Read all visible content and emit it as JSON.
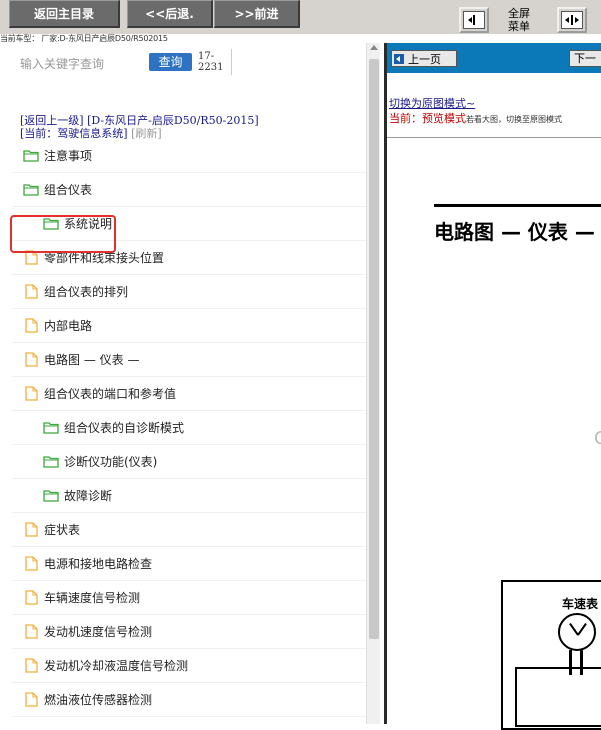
{
  "toolbar": {
    "back_main_label": "返回主目录",
    "back_label": "<<后退.",
    "forward_label": ">>前进",
    "fullscreen_line1": "全屏",
    "fullscreen_line2": "菜单",
    "vehicle_info": "当前车型： 厂家:D-东风日产启辰D50/R502015"
  },
  "search": {
    "placeholder": "输入关键字查询",
    "button_label": "查询",
    "code_line1": "17-",
    "code_line2": "2231"
  },
  "breadcrumb": {
    "back_up": "[返回上一级]",
    "path": "[D-东风日产-启辰D50/R50-2015]",
    "current": "[当前：驾驶信息系统]",
    "refresh": "[刷新]"
  },
  "tree": {
    "items": [
      {
        "label": "注意事项",
        "type": "folder",
        "level": 1
      },
      {
        "label": "组合仪表",
        "type": "folder",
        "level": 1,
        "highlighted": true
      },
      {
        "label": "系统说明",
        "type": "folder",
        "level": 2
      },
      {
        "label": "零部件和线束接头位置",
        "type": "doc",
        "level": 1
      },
      {
        "label": "组合仪表的排列",
        "type": "doc",
        "level": 1
      },
      {
        "label": "内部电路",
        "type": "doc",
        "level": 1
      },
      {
        "label": "电路图 — 仪表 —",
        "type": "doc",
        "level": 1
      },
      {
        "label": "组合仪表的端口和参考值",
        "type": "doc",
        "level": 1
      },
      {
        "label": "组合仪表的自诊断模式",
        "type": "folder",
        "level": 2
      },
      {
        "label": "诊断仪功能(仪表)",
        "type": "folder",
        "level": 2
      },
      {
        "label": "故障诊断",
        "type": "folder",
        "level": 2
      },
      {
        "label": "症状表",
        "type": "doc",
        "level": 1
      },
      {
        "label": "电源和接地电路检查",
        "type": "doc",
        "level": 1
      },
      {
        "label": "车辆速度信号检测",
        "type": "doc",
        "level": 1
      },
      {
        "label": "发动机速度信号检测",
        "type": "doc",
        "level": 1
      },
      {
        "label": "发动机冷却液温度信号检测",
        "type": "doc",
        "level": 1
      },
      {
        "label": "燃油液位传感器检测",
        "type": "doc",
        "level": 1
      }
    ]
  },
  "viewer": {
    "prev_page": "上一页",
    "next_page": "下一",
    "switch_mode": "切换为原图模式~",
    "current_mode": "当前：预览模式",
    "mode_hint": "若看大图，切换至原图模式",
    "heading": "电路图 — 仪表 —",
    "partial_char": "C",
    "diagram_label": "车速表"
  },
  "colors": {
    "toolbar_bg": "#d6d3ce",
    "nav_button_bg": "#6b6b6b",
    "query_button": "#2e73c3",
    "viewer_bar": "#0b78b8",
    "highlight": "#e03030",
    "folder_icon": "#3aa83a",
    "doc_icon": "#f0b040"
  }
}
